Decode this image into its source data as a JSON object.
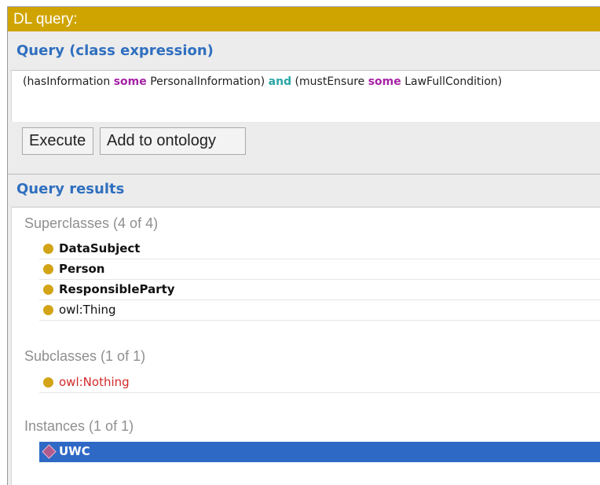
{
  "panel": {
    "title": "DL query:",
    "query_heading": "Query (class expression)",
    "results_heading": "Query results"
  },
  "query": {
    "part1": "(hasInformation ",
    "kw1": "some",
    "part2": " PersonalInformation) ",
    "kw2": "and",
    "part3": " (mustEnsure ",
    "kw3": "some",
    "part4": " LawFullCondition)"
  },
  "buttons": {
    "execute": "Execute",
    "add_to_ontology": "Add to ontology"
  },
  "results": {
    "superclasses": {
      "title": "Superclasses (4 of 4)",
      "items": [
        "DataSubject",
        "Person",
        "ResponsibleParty",
        "owl:Thing"
      ]
    },
    "subclasses": {
      "title": "Subclasses (1 of 1)",
      "items": [
        "owl:Nothing"
      ]
    },
    "instances": {
      "title": "Instances (1 of 1)",
      "items": [
        "UWC"
      ]
    }
  },
  "colors": {
    "title_bar": "#d0a400",
    "heading_blue": "#2f6fbf",
    "class_dot": "#d2a416",
    "selection": "#2f69c6",
    "nothing_red": "#d22a2a"
  }
}
